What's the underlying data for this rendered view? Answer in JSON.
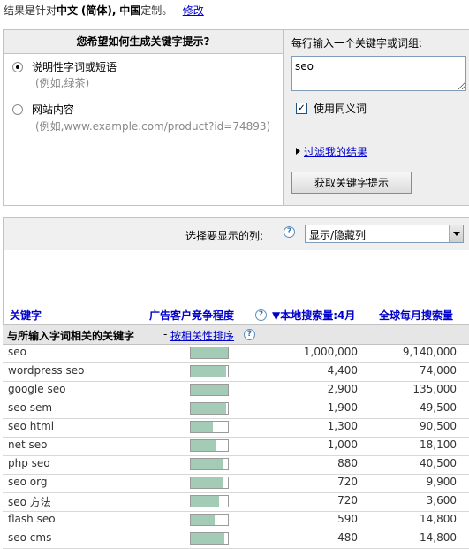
{
  "header": {
    "prefix": "结果是针对",
    "language": "中文",
    "variant": "(简体)",
    "sep": ",",
    "country": "中国",
    "suffix": "定制。",
    "modify_link": "修改"
  },
  "settings": {
    "question": "您希望如何生成关键字提示?",
    "option1": {
      "label": "说明性字词或短语",
      "hint": "(例如,绿茶)",
      "selected": true
    },
    "option2": {
      "label": "网站内容",
      "hint": "(例如,www.example.com/product?id=74893)",
      "selected": false
    },
    "input_label": "每行输入一个关键字或词组:",
    "input_value": "seo",
    "synonym_checked": true,
    "synonym_mark": "✓",
    "synonym_label": "使用同义词",
    "filter_link": "过滤我的结果",
    "submit_button": "获取关键字提示"
  },
  "columns_bar": {
    "label": "选择要显示的列:",
    "help_glyph": "?",
    "select_value": "显示/隐藏列"
  },
  "table": {
    "headers": {
      "keyword": "关键字",
      "competition": "广告客户竞争程度",
      "local": "▼本地搜索量:4月",
      "global": "全球每月搜索量"
    },
    "section_title": "与所输入字词相关的关键字",
    "section_dash": "-",
    "sort_link": "按相关性排序",
    "rows": [
      {
        "keyword": "seo",
        "competition": 1.0,
        "local": "1,000,000",
        "global": "9,140,000"
      },
      {
        "keyword": "wordpress seo",
        "competition": 0.95,
        "local": "4,400",
        "global": "74,000"
      },
      {
        "keyword": "google seo",
        "competition": 1.0,
        "local": "2,900",
        "global": "135,000"
      },
      {
        "keyword": "seo sem",
        "competition": 0.95,
        "local": "1,900",
        "global": "49,500"
      },
      {
        "keyword": "seo html",
        "competition": 0.6,
        "local": "1,300",
        "global": "90,500"
      },
      {
        "keyword": "net seo",
        "competition": 0.7,
        "local": "1,000",
        "global": "18,100"
      },
      {
        "keyword": "php seo",
        "competition": 0.85,
        "local": "880",
        "global": "40,500"
      },
      {
        "keyword": "seo org",
        "competition": 0.85,
        "local": "720",
        "global": "9,900"
      },
      {
        "keyword": "seo 方法",
        "competition": 0.75,
        "local": "720",
        "global": "3,600"
      },
      {
        "keyword": "flash seo",
        "competition": 0.65,
        "local": "590",
        "global": "14,800"
      },
      {
        "keyword": "seo cms",
        "competition": 0.9,
        "local": "480",
        "global": "14,800"
      }
    ]
  },
  "colors": {
    "link": "#0000cc",
    "bar_fill": "#a3cbb5",
    "panel_gray": "#eeeeee"
  }
}
